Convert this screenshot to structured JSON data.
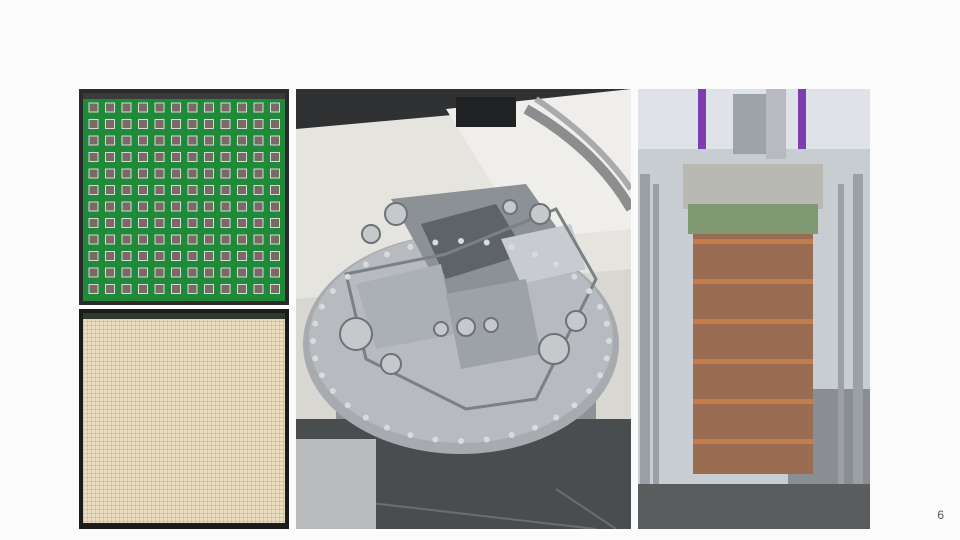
{
  "slide": {
    "page_number": "6",
    "background": "#fbfbfb"
  },
  "photos": [
    {
      "name": "pcb-pad-array-front-photo"
    },
    {
      "name": "pcb-pixel-grid-back-photo"
    },
    {
      "name": "cryostat-top-flange-photo"
    },
    {
      "name": "tpc-field-cage-frame-photo"
    }
  ],
  "colors": {
    "pcb_green": "#1f8a3a",
    "pcb_pad": "#7a6a66",
    "grid_bg": "#e8d9b8",
    "steel": "#9aa0a6",
    "copper": "#a8714f",
    "strap_purple": "#7b3fb0",
    "frame_green": "#7f9a72"
  }
}
